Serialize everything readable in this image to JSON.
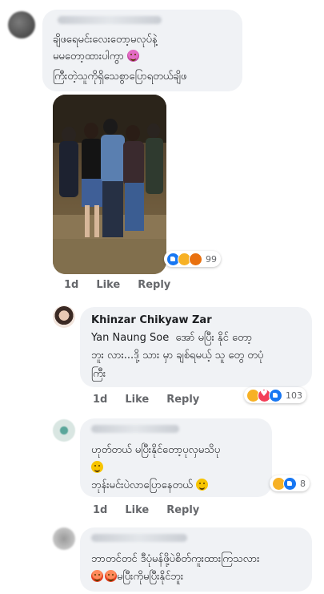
{
  "comments": [
    {
      "lines": [
        "ချိဖရေမင်းလေးတော့မလုပ်နဲ့",
        "မမတော့ထားပါကွာ",
        "ကြီးတဲ့သူကိုရှိသေစွာပြောရတယ်ချိဖ"
      ],
      "meta": {
        "time": "1d",
        "like": "Like",
        "reply": "Reply"
      },
      "reaction_count": "99"
    },
    {
      "author": "Khinzar Chikyaw Zar",
      "mention": "Yan Naung Soe",
      "line1_rest": "အော် မပြီး နိုင် တော့",
      "line2": "ဘူး လား...ဒို့ သား မှာ ချစ်ရမယ့် သူ တွေ တပုံ",
      "line3": "ကြီး",
      "meta": {
        "time": "1d",
        "like": "Like",
        "reply": "Reply"
      },
      "reaction_count": "103"
    },
    {
      "lines": [
        "ဟုတ်တယ် မပြီးနိုင်တော့ပုလှမသိပု",
        "",
        "ဘုန်းမင်းပဲလာပြောနေတယ်"
      ],
      "meta": {
        "time": "1d",
        "like": "Like",
        "reply": "Reply"
      },
      "reaction_count": "8"
    },
    {
      "lines": [
        "ဘာတင်တင် ဒီပုံမန်ဖို့ပဲစိတ်ကူးထားကြသလား",
        "မပြီးကိုမပြီးနိုင်ဘူး"
      ]
    }
  ],
  "colors": {
    "bubble": "#f0f2f5",
    "meta": "#65676b",
    "like": "#1877f2"
  }
}
